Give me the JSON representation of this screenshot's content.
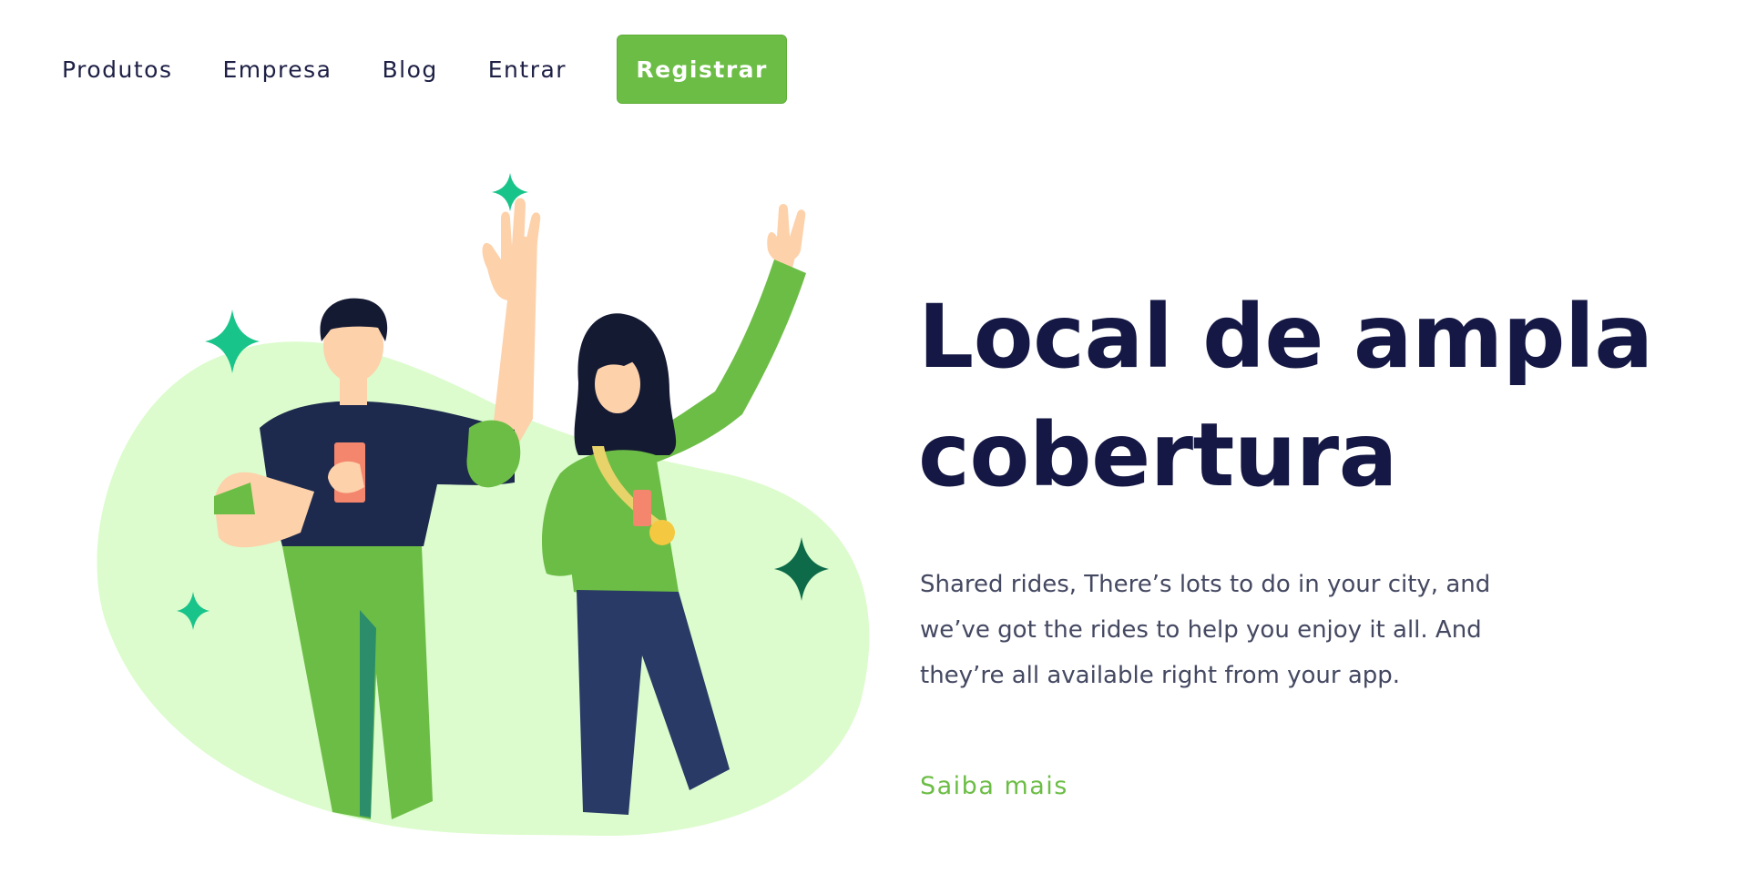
{
  "nav": {
    "links": [
      "Produtos",
      "Empresa",
      "Blog",
      "Entrar"
    ],
    "cta_label": "Registrar"
  },
  "hero": {
    "title_line1": "Local de ampla",
    "title_line2": "cobertura",
    "description": "Shared rides, There’s lots to do in your city, and we’ve got the rides to help you enjoy it all. And they’re all available right from your app.",
    "link_label": "Saiba mais"
  },
  "illustration": {
    "subject": "two people waving holding phones",
    "icons": [
      "sparkle-icon"
    ]
  },
  "colors": {
    "brand_green": "#6cbd45",
    "dark_navy": "#151844",
    "blob_green": "#dcfccd",
    "sparkle_green": "#18c48a",
    "sparkle_dark": "#0d6b4a"
  }
}
